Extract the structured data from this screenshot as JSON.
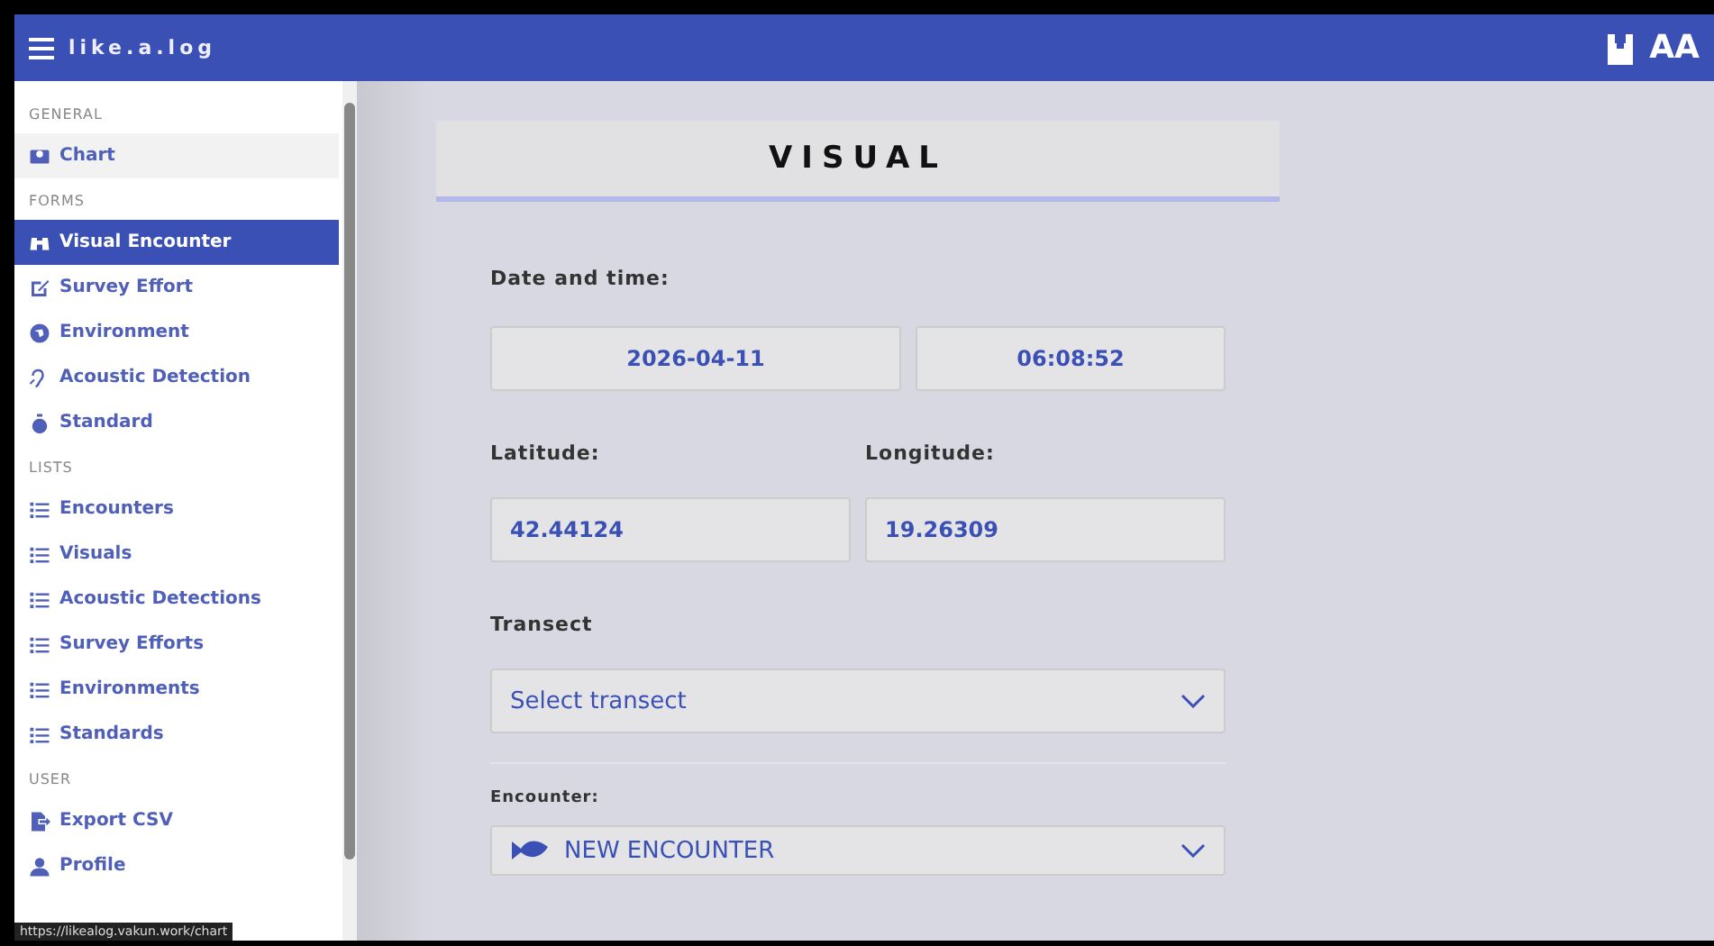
{
  "header": {
    "title": "like.a.log",
    "right_label": "AA"
  },
  "sidebar": {
    "sections": [
      {
        "title": "GENERAL",
        "items": [
          {
            "label": "Chart",
            "selected": false,
            "hovered": true
          }
        ]
      },
      {
        "title": "FORMS",
        "items": [
          {
            "label": "Visual Encounter",
            "selected": true,
            "hovered": false
          },
          {
            "label": "Survey Effort",
            "selected": false,
            "hovered": false
          },
          {
            "label": "Environment",
            "selected": false,
            "hovered": false
          },
          {
            "label": "Acoustic Detection",
            "selected": false,
            "hovered": false
          },
          {
            "label": "Standard",
            "selected": false,
            "hovered": false
          }
        ]
      },
      {
        "title": "LISTS",
        "items": [
          {
            "label": "Encounters",
            "selected": false,
            "hovered": false
          },
          {
            "label": "Visuals",
            "selected": false,
            "hovered": false
          },
          {
            "label": "Acoustic Detections",
            "selected": false,
            "hovered": false
          },
          {
            "label": "Survey Efforts",
            "selected": false,
            "hovered": false
          },
          {
            "label": "Environments",
            "selected": false,
            "hovered": false
          },
          {
            "label": "Standards",
            "selected": false,
            "hovered": false
          }
        ]
      },
      {
        "title": "USER",
        "items": [
          {
            "label": "Export CSV",
            "selected": false,
            "hovered": false
          },
          {
            "label": "Profile",
            "selected": false,
            "hovered": false
          }
        ]
      }
    ]
  },
  "status_url": "https://likealog.vakun.work/chart",
  "form": {
    "title": "VISUAL",
    "date_label": "Date and time:",
    "date": "2026-04-11",
    "time": "06:08:52",
    "latitude_label": "Latitude:",
    "latitude": "42.44124",
    "longitude_label": "Longitude:",
    "longitude": "19.26309",
    "transect_label": "Transect",
    "transect_placeholder": "Select transect",
    "encounter_label": "Encounter:",
    "encounter_value": "NEW ENCOUNTER"
  }
}
